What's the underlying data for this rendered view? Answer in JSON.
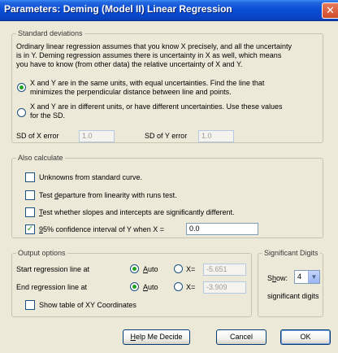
{
  "window": {
    "title": "Parameters: Deming (Model II) Linear Regression",
    "close_glyph": "✕"
  },
  "std_dev": {
    "legend": "Standard deviations",
    "description": [
      "Ordinary linear regression assumes that you know X precisely, and all the uncertainty",
      "is in Y. Deming regression assumes there is uncertainty in X as well, which means",
      "you have to know (from other data) the relative uncertainty of X and Y."
    ],
    "option_same": {
      "lines": [
        "X and Y are in the same units, with equal uncertainties. Find the line that",
        "minimizes the perpendicular distance between line and points."
      ],
      "selected": true
    },
    "option_different": {
      "lines": [
        "X and Y are in different units, or have different uncertainties. Use these values",
        "for the SD."
      ],
      "selected": false
    },
    "sd_x_label": "SD of X error",
    "sd_x_value": "1.0",
    "sd_y_label": "SD of Y error",
    "sd_y_value": "1.0"
  },
  "also_calculate": {
    "legend": "Also calculate",
    "unknowns": {
      "label": "Unknowns from standard curve.",
      "checked": false
    },
    "runs_test": {
      "pre": "Test ",
      "accel": "d",
      "post": "eparture from linearity with runs test.",
      "checked": false
    },
    "slopes_test": {
      "accel": "T",
      "post": "est whether slopes and intercepts are significantly different.",
      "checked": false
    },
    "confidence": {
      "accel": "9",
      "post": "5% confidence interval of Y when X =",
      "checked": true,
      "value": "0.0"
    }
  },
  "output": {
    "legend": "Output options",
    "start_label": "Start regression line at",
    "end_label": "End regression line at",
    "auto_accel": "A",
    "auto_rest": "uto",
    "x_equals": "X=",
    "start_auto": true,
    "end_auto": true,
    "start_value": "-5.651",
    "end_value": "-3.909",
    "table_label": "Show table of XY Coordinates",
    "table_checked": false
  },
  "significant": {
    "legend": "Significant Digits",
    "show_pre": "S",
    "show_accel": "h",
    "show_post": "ow:",
    "value": "4",
    "suffix": "significant digits"
  },
  "buttons": {
    "help_accel": "H",
    "help_rest": "elp Me Decide",
    "cancel": "Cancel",
    "ok": "OK"
  },
  "icons": {
    "check_glyph": "✓",
    "dropdown_glyph": "▼"
  }
}
